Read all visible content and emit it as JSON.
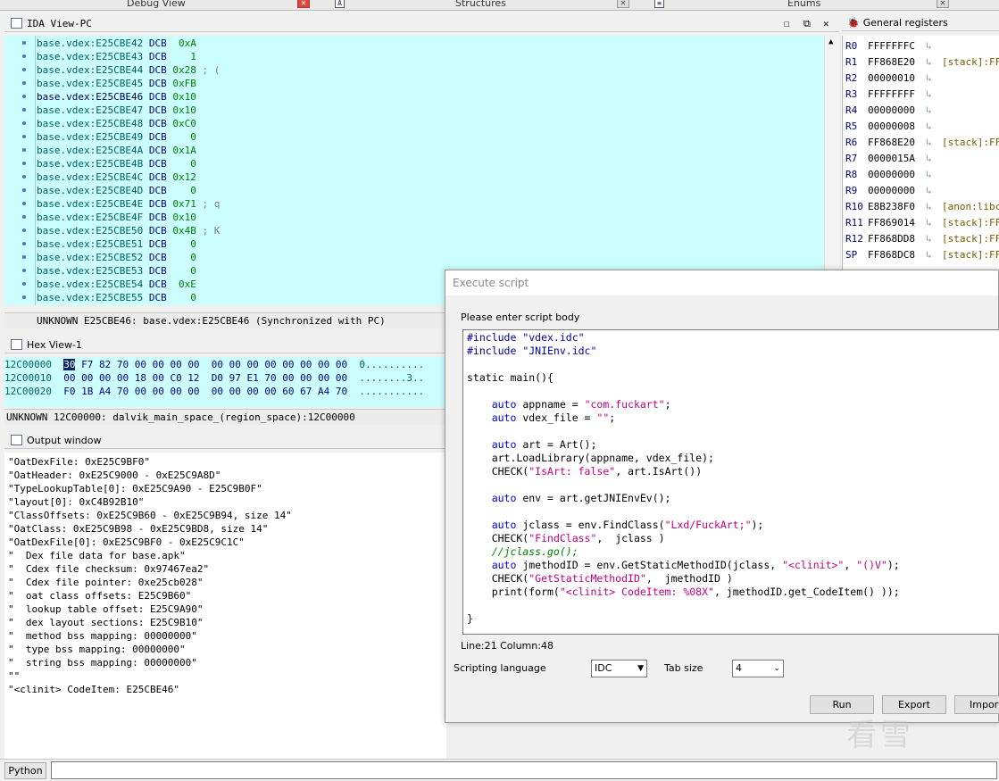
{
  "top_tabs": {
    "debug_view": "Debug View",
    "structures": "Structures",
    "enums": "Enums"
  },
  "ida_view": {
    "title": "IDA View-PC",
    "lines": [
      {
        "addr": "base.vdex:E25CBE42",
        "op": "DCB",
        "val": "  0xA",
        "comment": ""
      },
      {
        "addr": "base.vdex:E25CBE43",
        "op": "DCB",
        "val": "    1",
        "comment": ""
      },
      {
        "addr": "base.vdex:E25CBE44",
        "op": "DCB",
        "val": " 0x28",
        "comment": " ; ("
      },
      {
        "addr": "base.vdex:E25CBE45",
        "op": "DCB",
        "val": " 0xFB",
        "comment": ""
      },
      {
        "addr": "base.vdex:E25CBE46",
        "op": "DCB",
        "val": " 0x10",
        "comment": ""
      },
      {
        "addr": "base.vdex:E25CBE47",
        "op": "DCB",
        "val": " 0x10",
        "comment": ""
      },
      {
        "addr": "base.vdex:E25CBE48",
        "op": "DCB",
        "val": " 0xC0",
        "comment": ""
      },
      {
        "addr": "base.vdex:E25CBE49",
        "op": "DCB",
        "val": "    0",
        "comment": ""
      },
      {
        "addr": "base.vdex:E25CBE4A",
        "op": "DCB",
        "val": " 0x1A",
        "comment": ""
      },
      {
        "addr": "base.vdex:E25CBE4B",
        "op": "DCB",
        "val": "    0",
        "comment": ""
      },
      {
        "addr": "base.vdex:E25CBE4C",
        "op": "DCB",
        "val": " 0x12",
        "comment": ""
      },
      {
        "addr": "base.vdex:E25CBE4D",
        "op": "DCB",
        "val": "    0",
        "comment": ""
      },
      {
        "addr": "base.vdex:E25CBE4E",
        "op": "DCB",
        "val": " 0x71",
        "comment": " ; q"
      },
      {
        "addr": "base.vdex:E25CBE4F",
        "op": "DCB",
        "val": " 0x10",
        "comment": ""
      },
      {
        "addr": "base.vdex:E25CBE50",
        "op": "DCB",
        "val": " 0x4B",
        "comment": " ; K"
      },
      {
        "addr": "base.vdex:E25CBE51",
        "op": "DCB",
        "val": "    0",
        "comment": ""
      },
      {
        "addr": "base.vdex:E25CBE52",
        "op": "DCB",
        "val": "    0",
        "comment": ""
      },
      {
        "addr": "base.vdex:E25CBE53",
        "op": "DCB",
        "val": "    0",
        "comment": ""
      },
      {
        "addr": "base.vdex:E25CBE54",
        "op": "DCB",
        "val": "  0xE",
        "comment": ""
      },
      {
        "addr": "base.vdex:E25CBE55",
        "op": "DCB",
        "val": "    0",
        "comment": ""
      }
    ],
    "status": "UNKNOWN E25CBE46: base.vdex:E25CBE46 (Synchronized with PC)"
  },
  "registers": {
    "title": "General registers",
    "rows": [
      {
        "name": "R0",
        "value": "FFFFFFFC",
        "ptr": ""
      },
      {
        "name": "R1",
        "value": "FF868E20",
        "ptr": "[stack]:FF"
      },
      {
        "name": "R2",
        "value": "00000010",
        "ptr": ""
      },
      {
        "name": "R3",
        "value": "FFFFFFFF",
        "ptr": ""
      },
      {
        "name": "R4",
        "value": "00000000",
        "ptr": ""
      },
      {
        "name": "R5",
        "value": "00000008",
        "ptr": ""
      },
      {
        "name": "R6",
        "value": "FF868E20",
        "ptr": "[stack]:FF"
      },
      {
        "name": "R7",
        "value": "0000015A",
        "ptr": ""
      },
      {
        "name": "R8",
        "value": "00000000",
        "ptr": ""
      },
      {
        "name": "R9",
        "value": "00000000",
        "ptr": ""
      },
      {
        "name": "R10",
        "value": "E8B238F0",
        "ptr": "[anon:libc"
      },
      {
        "name": "R11",
        "value": "FF869014",
        "ptr": "[stack]:FF"
      },
      {
        "name": "R12",
        "value": "FF868DD8",
        "ptr": "[stack]:FF"
      },
      {
        "name": "SP",
        "value": "FF868DC8",
        "ptr": "[stack]:FF"
      }
    ]
  },
  "hex_view": {
    "title": "Hex View-1",
    "rows": [
      {
        "addr": "12C00000",
        "first": "30",
        "bytes": " F7 82 70 00 00 00 00  00 00 00 00 00 00 00 00",
        "ascii": "0.........."
      },
      {
        "addr": "12C00010",
        "first": "",
        "bytes": "00 00 00 00 18 00 C0 12  D0 97 E1 70 00 00 00 00",
        "ascii": "........3.."
      },
      {
        "addr": "12C00020",
        "first": "",
        "bytes": "F0 1B A4 70 00 00 00 00  00 00 00 00 60 67 A4 70",
        "ascii": "..........."
      }
    ],
    "status": "UNKNOWN 12C00000: dalvik_main_space_(region_space):12C00000"
  },
  "output": {
    "title": "Output window",
    "lines": [
      "\"OatDexFile: 0xE25C9BF0\"",
      "\"OatHeader: 0xE25C9000 - 0xE25C9A8D\"",
      "\"TypeLookupTable[0]: 0xE25C9A90 - E25C9B0F\"",
      "\"layout[0]: 0xC4B92B10\"",
      "\"ClassOffsets: 0xE25C9B60 - 0xE25C9B94, size 14\"",
      "\"OatClass: 0xE25C9B98 - 0xE25C9BD8, size 14\"",
      "\"OatDexFile[0]: 0xE25C9BF0 - 0xE25C9C1C\"",
      "\"  Dex file data for base.apk\"",
      "\"  Cdex file checksum: 0x97467ea2\"",
      "\"  Cdex file pointer: 0xe25cb028\"",
      "\"  oat class offsets: E25C9B60\"",
      "\"  lookup table offset: E25C9A90\"",
      "\"  dex layout sections: E25C9B10\"",
      "\"  method bss mapping: 00000000\"",
      "\"  type bss mapping: 00000000\"",
      "\"  string bss mapping: 00000000\"",
      "\"\"",
      "\"<clinit> CodeItem: E25CBE46\""
    ]
  },
  "python_bar": {
    "button": "Python"
  },
  "dialog": {
    "title": "Execute script",
    "prompt": "Please enter script body",
    "line_col": "Line:21 Column:48",
    "scripting_language_label": "Scripting language",
    "scripting_language_value": "IDC",
    "tab_size_label": "Tab size",
    "tab_size_value": "4",
    "run_button": "Run",
    "export_button": "Export",
    "import_button": "Import",
    "code": {
      "l1a": "#include ",
      "l1b": "\"vdex.idc\"",
      "l2a": "#include ",
      "l2b": "\"JNIEnv.idc\"",
      "l4": "static main(){",
      "l6a": "    auto",
      "l6b": " appname = ",
      "l6c": "\"com.fuckart\"",
      "l6d": ";",
      "l7a": "    auto",
      "l7b": " vdex_file = ",
      "l7c": "\"\"",
      "l7d": ";",
      "l9a": "    auto",
      "l9b": " art = Art();",
      "l10": "    art.LoadLibrary(appname, vdex_file);",
      "l11a": "    CHECK(",
      "l11b": "\"IsArt: false\"",
      "l11c": ", art.IsArt())",
      "l13a": "    auto",
      "l13b": " env = art.getJNIEnvEv();",
      "l15a": "    auto",
      "l15b": " jclass = env.FindClass(",
      "l15c": "\"Lxd/FuckArt;\"",
      "l15d": ");",
      "l16a": "    CHECK(",
      "l16b": "\"FindClass\"",
      "l16c": ",  jclass )",
      "l17": "    //jclass.go();",
      "l18a": "    auto",
      "l18b": " jmethodID = env.GetStaticMethodID(jclass, ",
      "l18c": "\"<clinit>\"",
      "l18d": ", ",
      "l18e": "\"()V\"",
      "l18f": ");",
      "l19a": "    CHECK(",
      "l19b": "\"GetStaticMethodID\"",
      "l19c": ",  jmethodID )",
      "l20a": "    print(form(",
      "l20b": "\"<clinit> CodeItem: %08X\"",
      "l20c": ", jmethodID.get_CodeItem() ));",
      "l22": "}"
    }
  },
  "watermark": "看雪",
  "colors": {
    "ida_bg": "#ccffff",
    "keyword": "#0000d0",
    "string": "#c00080",
    "comment": "#008000"
  }
}
